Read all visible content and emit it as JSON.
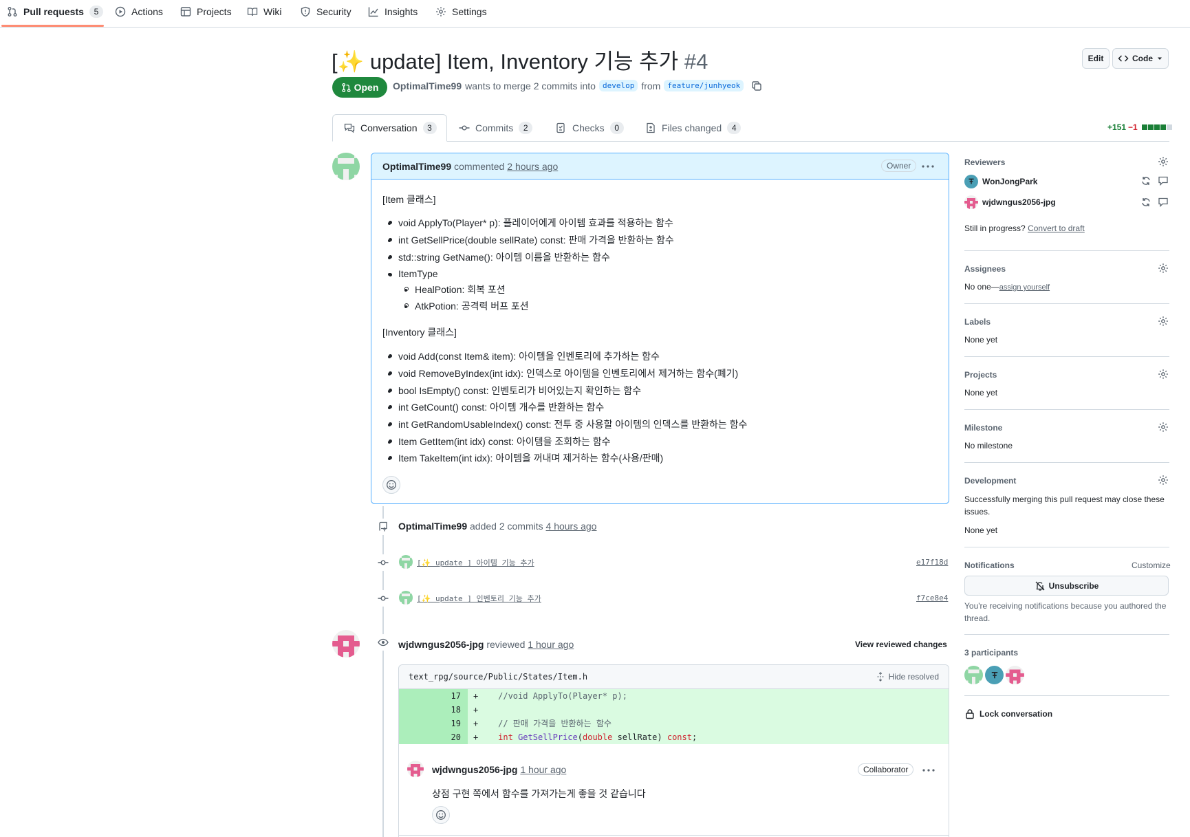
{
  "nav": {
    "items": [
      {
        "label": "Pull requests",
        "count": "5"
      },
      {
        "label": "Actions"
      },
      {
        "label": "Projects"
      },
      {
        "label": "Wiki"
      },
      {
        "label": "Security"
      },
      {
        "label": "Insights"
      },
      {
        "label": "Settings"
      }
    ]
  },
  "pr": {
    "title": "[✨ update] Item, Inventory 기능 추가",
    "number": "#4",
    "edit_label": "Edit",
    "code_label": "Code",
    "state": "Open",
    "author": "OptimalTime99",
    "meta_middle": "wants to merge 2 commits into",
    "base_branch": "develop",
    "from_word": "from",
    "head_branch": "feature/junhyeok"
  },
  "tabs": [
    {
      "label": "Conversation",
      "count": "3"
    },
    {
      "label": "Commits",
      "count": "2"
    },
    {
      "label": "Checks",
      "count": "0"
    },
    {
      "label": "Files changed",
      "count": "4"
    }
  ],
  "diffstat": {
    "additions": "+151",
    "deletions": "−1"
  },
  "comment": {
    "author": "OptimalTime99",
    "action": "commented",
    "time": "2 hours ago",
    "role": "Owner",
    "item_heading": "[Item 클래스]",
    "item_methods": [
      "void ApplyTo(Player* p): 플레이어에게 아이템 효과를 적용하는 함수",
      "int GetSellPrice(double sellRate) const: 판매 가격을 반환하는 함수",
      "std::string GetName(): 아이템 이름을 반환하는 함수",
      "ItemType"
    ],
    "item_types": [
      "HealPotion: 회복 포션",
      "AtkPotion: 공격력 버프 포션"
    ],
    "inventory_heading": "[Inventory 클래스]",
    "inventory_methods": [
      "void Add(const Item& item): 아이템을 인벤토리에 추가하는 함수",
      "void RemoveByIndex(int idx): 인덱스로 아이템을 인벤토리에서 제거하는 함수(폐기)",
      "bool IsEmpty() const: 인벤토리가 비어있는지 확인하는 함수",
      "int GetCount() const: 아이템 개수를 반환하는 함수",
      "int GetRandomUsableIndex() const: 전투 중 사용할 아이템의 인덱스를 반환하는 함수",
      "Item GetItem(int idx) const: 아이템을 조회하는 함수",
      "Item TakeItem(int idx): 아이템을 꺼내며 제거하는 함수(사용/판매)"
    ]
  },
  "commits_event": {
    "author": "OptimalTime99",
    "action": "added 2 commits",
    "time": "4 hours ago",
    "commits": [
      {
        "message": "[✨ update ] 아이템 기능 추가",
        "sha": "e17f18d"
      },
      {
        "message": "[✨ update ] 인벤토리 기능 추가",
        "sha": "f7ce8e4"
      }
    ]
  },
  "review": {
    "author": "wjdwngus2056-jpg",
    "action": "reviewed",
    "time": "1 hour ago",
    "view_changes": "View reviewed changes",
    "file_path": "text_rpg/source/Public/States/Item.h",
    "hide_resolved": "Hide resolved",
    "lines": [
      {
        "num": "17",
        "sign": "+",
        "code": "    //void ApplyTo(Player* p);"
      },
      {
        "num": "18",
        "sign": "+",
        "code": ""
      },
      {
        "num": "19",
        "sign": "+",
        "code": "    // 판매 가격을 반환하는 함수"
      },
      {
        "num": "20",
        "sign": "+",
        "code_kw1": "int",
        "code_fn": "GetSellPrice",
        "code_p1": "(",
        "code_kw2": "double",
        "code_p2": " sellRate) ",
        "code_kw3": "const",
        "code_p3": ";"
      }
    ],
    "reply": {
      "author": "wjdwngus2056-jpg",
      "time": "1 hour ago",
      "role": "Collaborator",
      "body": "상점 구현 쪽에서 함수를 가져가는게 좋을 것 같습니다"
    }
  },
  "sidebar": {
    "reviewers_title": "Reviewers",
    "reviewers": [
      {
        "name": "WonJongPark"
      },
      {
        "name": "wjdwngus2056-jpg"
      }
    ],
    "still_in_progress": "Still in progress?",
    "convert_to_draft": "Convert to draft",
    "assignees_title": "Assignees",
    "assignees_none": "No one—",
    "assign_yourself": "assign yourself",
    "labels_title": "Labels",
    "labels_value": "None yet",
    "projects_title": "Projects",
    "projects_value": "None yet",
    "milestone_title": "Milestone",
    "milestone_value": "No milestone",
    "development_title": "Development",
    "development_text": "Successfully merging this pull request may close these issues.",
    "development_value": "None yet",
    "notifications_title": "Notifications",
    "customize": "Customize",
    "unsubscribe": "Unsubscribe",
    "notif_reason": "You're receiving notifications because you authored the thread.",
    "participants": "3 participants",
    "lock": "Lock conversation"
  },
  "colors": {
    "open_green": "#1f883d",
    "link_blue": "#0969da",
    "owner_bg": "#ddf4ff",
    "addition_bg": "#dafbe1",
    "addition_num_bg": "#aceebb"
  }
}
